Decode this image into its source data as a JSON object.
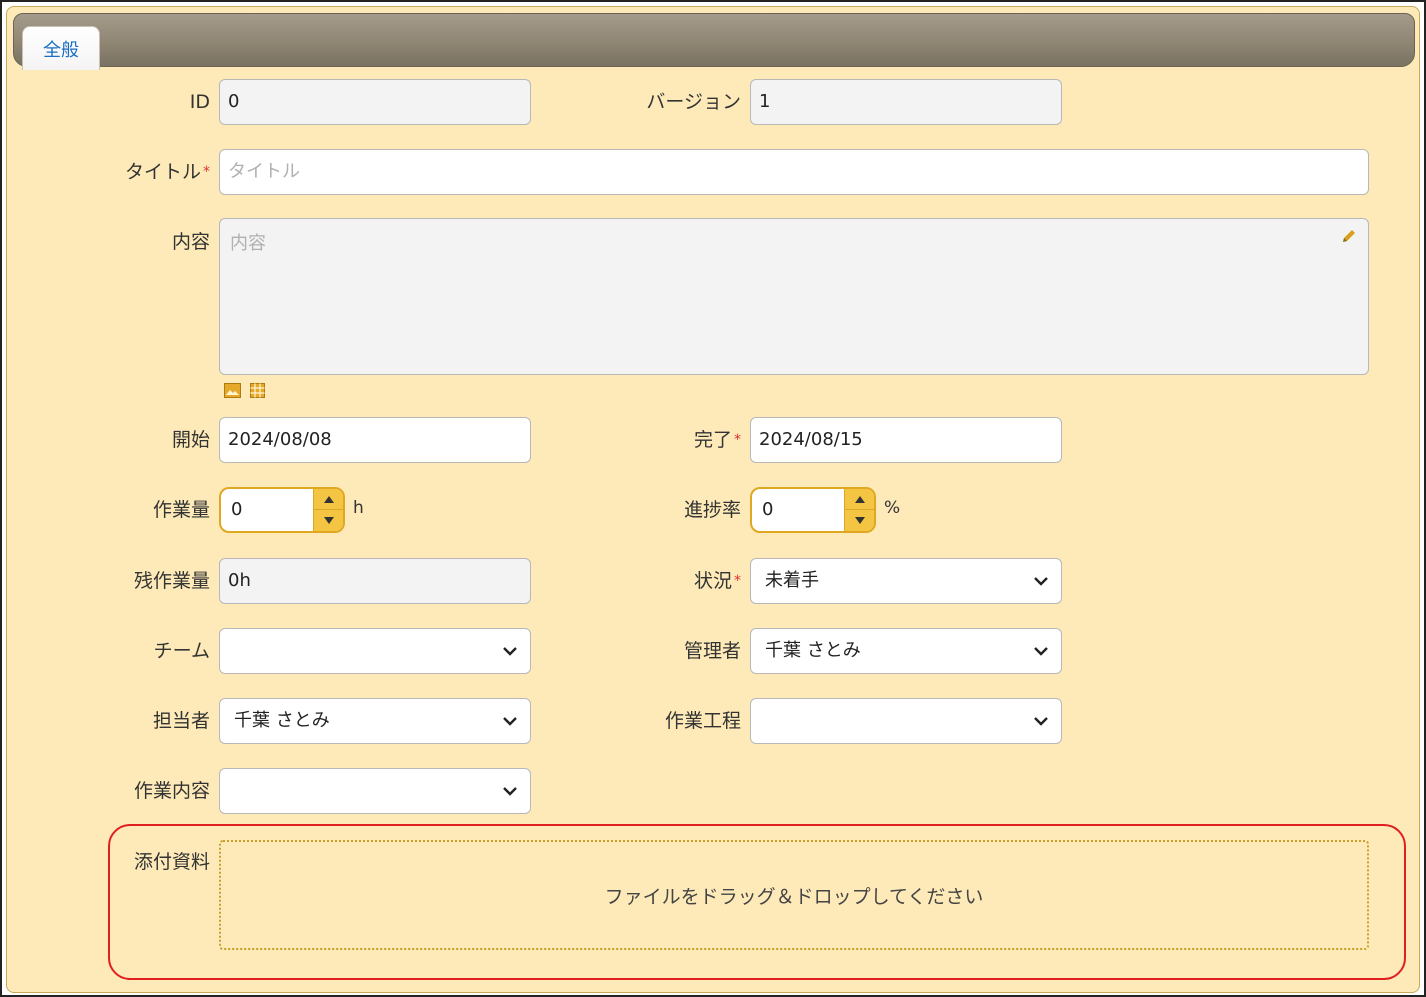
{
  "tab": {
    "label": "全般"
  },
  "fields": {
    "id": {
      "label": "ID",
      "value": "0"
    },
    "version": {
      "label": "バージョン",
      "value": "1"
    },
    "title": {
      "label": "タイトル",
      "required": "*",
      "placeholder": "タイトル"
    },
    "content": {
      "label": "内容",
      "placeholder": "内容"
    },
    "start": {
      "label": "開始",
      "value": "2024/08/08"
    },
    "end": {
      "label": "完了",
      "required": "*",
      "value": "2024/08/15"
    },
    "workload": {
      "label": "作業量",
      "value": "0",
      "unit": "h"
    },
    "progress": {
      "label": "進捗率",
      "value": "0",
      "unit": "%"
    },
    "remaining": {
      "label": "残作業量",
      "value": "0h"
    },
    "status": {
      "label": "状況",
      "required": "*",
      "value": "未着手"
    },
    "team": {
      "label": "チーム",
      "value": ""
    },
    "manager": {
      "label": "管理者",
      "value": "千葉 さとみ"
    },
    "assignee": {
      "label": "担当者",
      "value": "千葉 さとみ"
    },
    "process": {
      "label": "作業工程",
      "value": ""
    },
    "work_content": {
      "label": "作業内容",
      "value": ""
    },
    "attachments": {
      "label": "添付資料",
      "dropzone_text": "ファイルをドラッグ＆ドロップしてください"
    }
  },
  "colors": {
    "panel_bg": "#fdeab8",
    "tab_text": "#1a6fc4",
    "required": "#e03030",
    "highlight": "#e02020",
    "accent": "#e0a820"
  },
  "icons": [
    "pencil-icon",
    "image-icon",
    "table-icon",
    "chevron-down-icon",
    "caret-up-icon",
    "caret-down-icon"
  ]
}
